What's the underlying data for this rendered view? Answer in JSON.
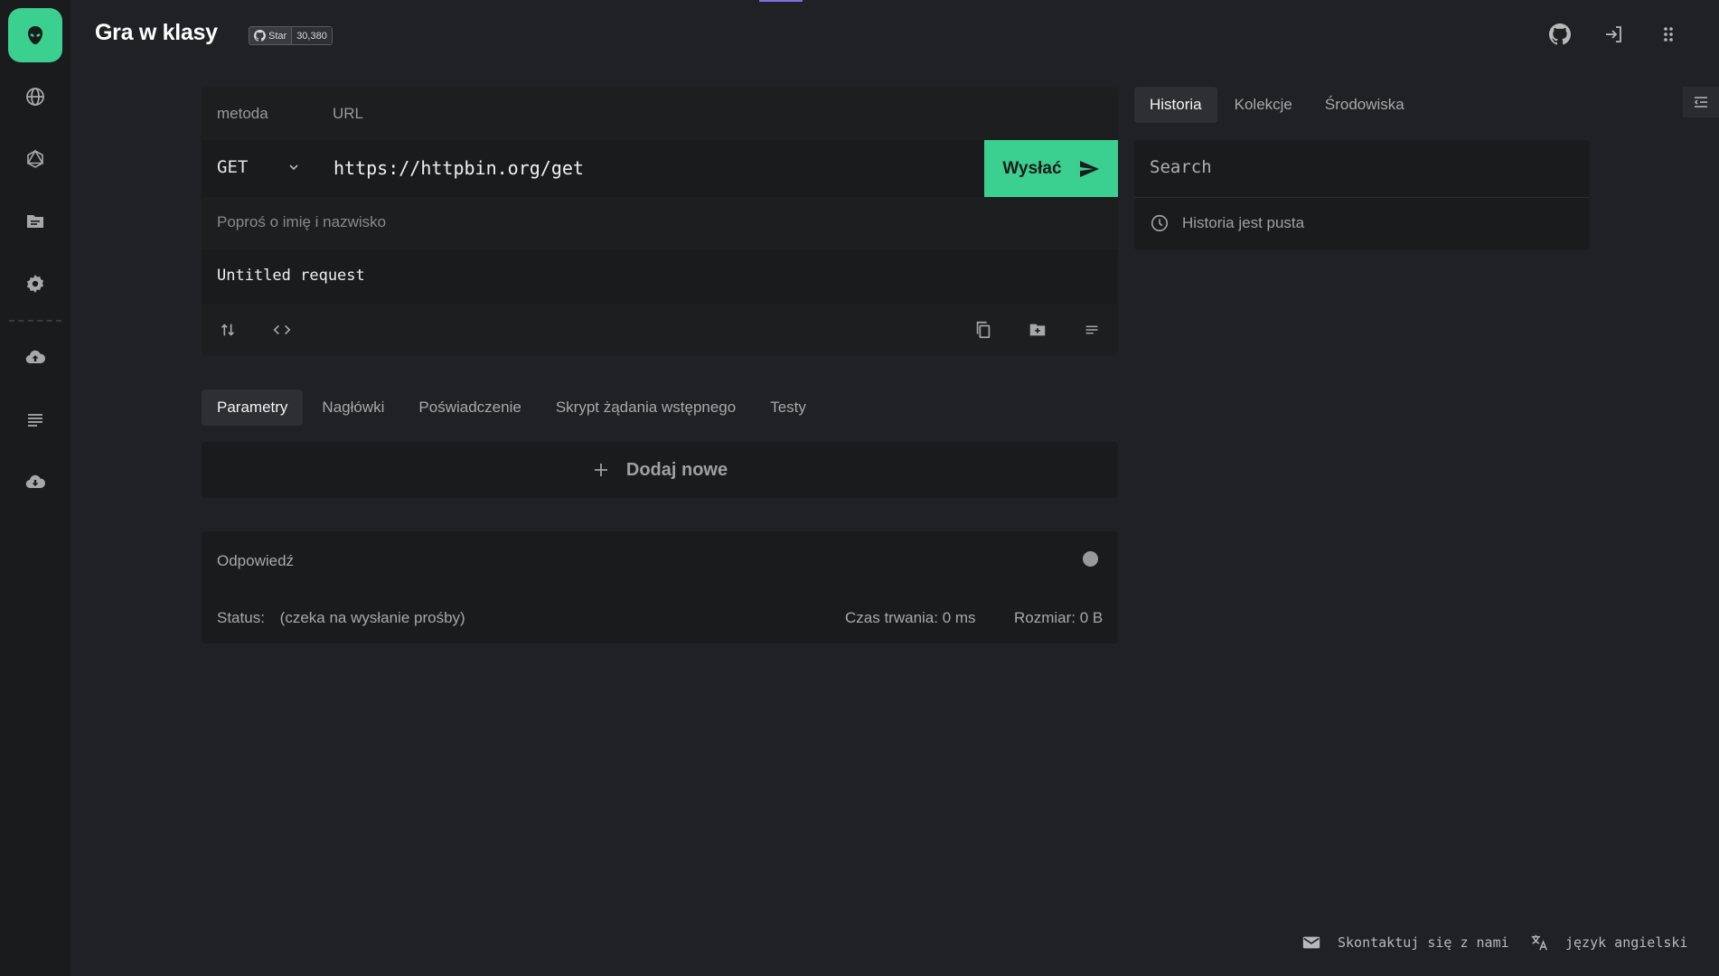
{
  "app": {
    "title": "Gra w klasy"
  },
  "github_badge": {
    "star_label": "Star",
    "count": "30,380"
  },
  "colors": {
    "accent": "#3bd08f",
    "background": "#202124",
    "panel": "#1a1b1d"
  },
  "sidebar": {
    "items": [
      {
        "name": "logo",
        "icon": "alien-icon"
      },
      {
        "name": "rest",
        "icon": "globe-icon"
      },
      {
        "name": "graphql",
        "icon": "graphql-icon"
      },
      {
        "name": "documentation",
        "icon": "folder-icon"
      },
      {
        "name": "settings",
        "icon": "gear-icon"
      },
      {
        "name": "upload",
        "icon": "cloud-upload-icon"
      },
      {
        "name": "menu",
        "icon": "list-icon"
      },
      {
        "name": "download",
        "icon": "cloud-download-icon"
      }
    ]
  },
  "request": {
    "method_label": "metoda",
    "url_label": "URL",
    "method": "GET",
    "url": "https://httpbin.org/get",
    "send_label": "Wysłać",
    "name_label": "Poproś o imię i nazwisko",
    "name": "Untitled request"
  },
  "tabs": [
    {
      "label": "Parametry",
      "active": true
    },
    {
      "label": "Nagłówki"
    },
    {
      "label": "Poświadczenie"
    },
    {
      "label": "Skrypt żądania wstępnego"
    },
    {
      "label": "Testy"
    }
  ],
  "params": {
    "add_label": "Dodaj nowe"
  },
  "response": {
    "title": "Odpowiedź",
    "status_label": "Status:",
    "status_value": "(czeka na wysłanie prośby)",
    "duration": "Czas trwania: 0 ms",
    "size": "Rozmiar: 0 B"
  },
  "right_tabs": [
    {
      "label": "Historia",
      "active": true
    },
    {
      "label": "Kolekcje"
    },
    {
      "label": "Środowiska"
    }
  ],
  "history": {
    "search_placeholder": "Search",
    "empty_text": "Historia jest pusta"
  },
  "footer": {
    "contact": "Skontaktuj się z nami",
    "language": "język angielski"
  }
}
